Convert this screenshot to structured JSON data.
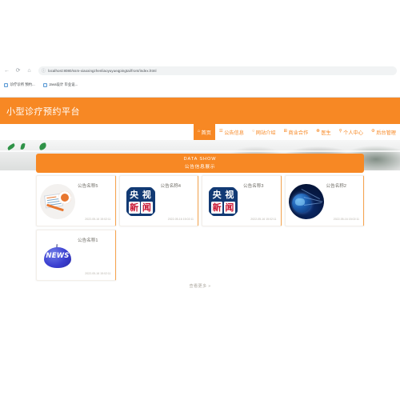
{
  "browser": {
    "back_icon": "←",
    "reload_icon": "⟳",
    "home_icon": "⌂",
    "security_icon": "ⓘ",
    "url": "localhost:8080/ssm-xiaoxingzhenliaoyuyueqpingtai/front/index.html",
    "bookmarks": [
      {
        "label": "诊疗诊所 预约..."
      },
      {
        "label": "Java设计 毕业设..."
      }
    ]
  },
  "site": {
    "title": "小型诊疗预约平台",
    "accent_color": "#f78824",
    "nav": [
      {
        "icon": "⌂",
        "label": "首页",
        "active": true
      },
      {
        "icon": "☰",
        "label": "公告信息",
        "active": false
      },
      {
        "icon": "○",
        "label": "网站介绍",
        "active": false
      },
      {
        "icon": "⊞",
        "label": "商业合作",
        "active": false
      },
      {
        "icon": "❁",
        "label": "医生",
        "active": false
      },
      {
        "icon": "⚲",
        "label": "个人中心",
        "active": false
      },
      {
        "icon": "⚙",
        "label": "后台管理",
        "active": false
      }
    ],
    "banner": {
      "en": "DATA SHOW",
      "cn": "公告信息展示"
    },
    "cards": [
      {
        "title": "公告名称5",
        "date": "2022-05-16 15:02:11",
        "thumb": "document-pen-image"
      },
      {
        "title": "公告名称4",
        "date": "2022-05-16 15:02:11",
        "thumb": "cctv-news-logo"
      },
      {
        "title": "公告名称3",
        "date": "2022-05-16 15:02:11",
        "thumb": "cctv-news-logo"
      },
      {
        "title": "公告名称2",
        "date": "2022-05-16 15:02:11",
        "thumb": "globe-network-image"
      },
      {
        "title": "公告名称1",
        "date": "2022-05-16 15:02:11",
        "thumb": "news-apple-logo"
      }
    ],
    "more_link": "查看更多 »",
    "cctv_logo": {
      "top": [
        "央",
        "视"
      ],
      "bottom": [
        "新",
        "闻"
      ]
    },
    "news_logo_text": "NEWS"
  }
}
